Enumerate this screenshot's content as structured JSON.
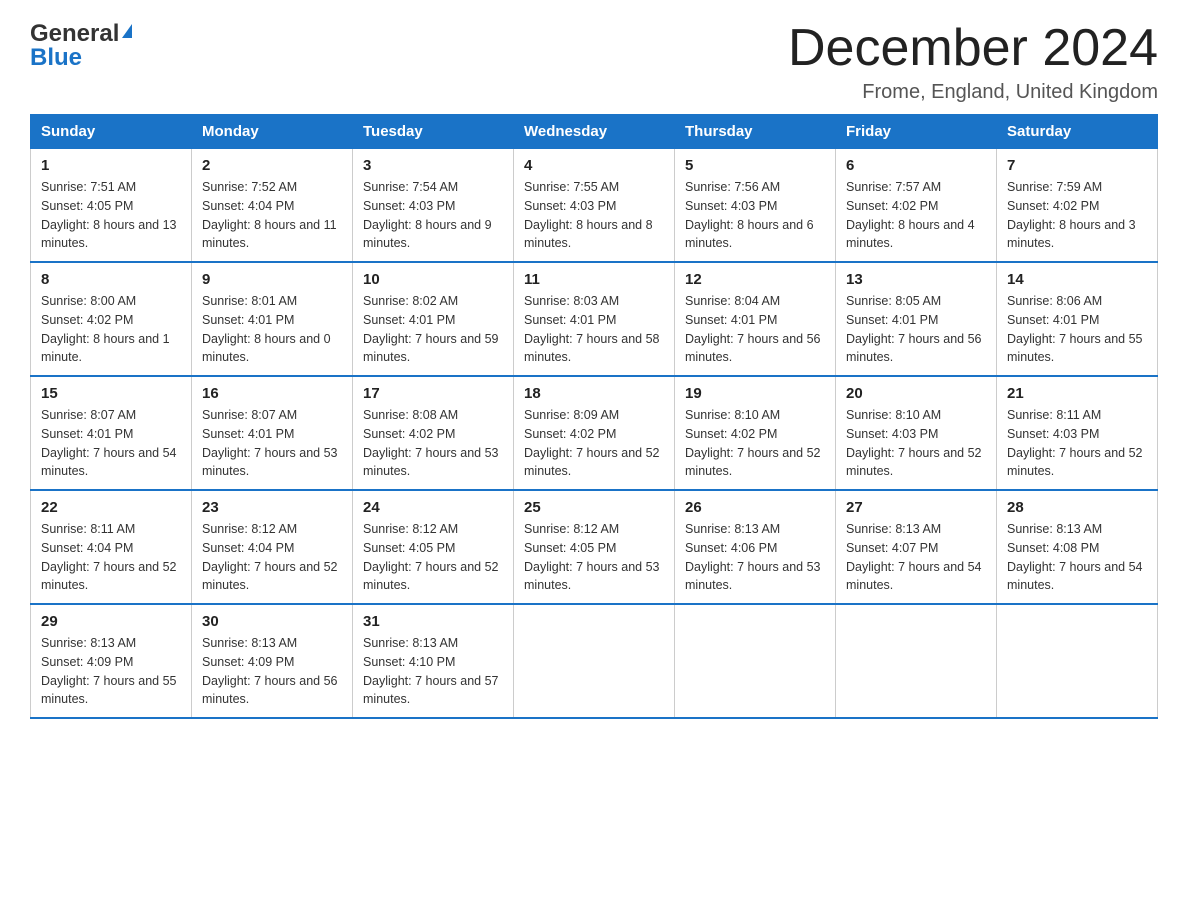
{
  "header": {
    "logo_general": "General",
    "logo_blue": "Blue",
    "title": "December 2024",
    "location": "Frome, England, United Kingdom"
  },
  "columns": [
    "Sunday",
    "Monday",
    "Tuesday",
    "Wednesday",
    "Thursday",
    "Friday",
    "Saturday"
  ],
  "weeks": [
    [
      {
        "day": "1",
        "sunrise": "7:51 AM",
        "sunset": "4:05 PM",
        "daylight": "8 hours and 13 minutes."
      },
      {
        "day": "2",
        "sunrise": "7:52 AM",
        "sunset": "4:04 PM",
        "daylight": "8 hours and 11 minutes."
      },
      {
        "day": "3",
        "sunrise": "7:54 AM",
        "sunset": "4:03 PM",
        "daylight": "8 hours and 9 minutes."
      },
      {
        "day": "4",
        "sunrise": "7:55 AM",
        "sunset": "4:03 PM",
        "daylight": "8 hours and 8 minutes."
      },
      {
        "day": "5",
        "sunrise": "7:56 AM",
        "sunset": "4:03 PM",
        "daylight": "8 hours and 6 minutes."
      },
      {
        "day": "6",
        "sunrise": "7:57 AM",
        "sunset": "4:02 PM",
        "daylight": "8 hours and 4 minutes."
      },
      {
        "day": "7",
        "sunrise": "7:59 AM",
        "sunset": "4:02 PM",
        "daylight": "8 hours and 3 minutes."
      }
    ],
    [
      {
        "day": "8",
        "sunrise": "8:00 AM",
        "sunset": "4:02 PM",
        "daylight": "8 hours and 1 minute."
      },
      {
        "day": "9",
        "sunrise": "8:01 AM",
        "sunset": "4:01 PM",
        "daylight": "8 hours and 0 minutes."
      },
      {
        "day": "10",
        "sunrise": "8:02 AM",
        "sunset": "4:01 PM",
        "daylight": "7 hours and 59 minutes."
      },
      {
        "day": "11",
        "sunrise": "8:03 AM",
        "sunset": "4:01 PM",
        "daylight": "7 hours and 58 minutes."
      },
      {
        "day": "12",
        "sunrise": "8:04 AM",
        "sunset": "4:01 PM",
        "daylight": "7 hours and 56 minutes."
      },
      {
        "day": "13",
        "sunrise": "8:05 AM",
        "sunset": "4:01 PM",
        "daylight": "7 hours and 56 minutes."
      },
      {
        "day": "14",
        "sunrise": "8:06 AM",
        "sunset": "4:01 PM",
        "daylight": "7 hours and 55 minutes."
      }
    ],
    [
      {
        "day": "15",
        "sunrise": "8:07 AM",
        "sunset": "4:01 PM",
        "daylight": "7 hours and 54 minutes."
      },
      {
        "day": "16",
        "sunrise": "8:07 AM",
        "sunset": "4:01 PM",
        "daylight": "7 hours and 53 minutes."
      },
      {
        "day": "17",
        "sunrise": "8:08 AM",
        "sunset": "4:02 PM",
        "daylight": "7 hours and 53 minutes."
      },
      {
        "day": "18",
        "sunrise": "8:09 AM",
        "sunset": "4:02 PM",
        "daylight": "7 hours and 52 minutes."
      },
      {
        "day": "19",
        "sunrise": "8:10 AM",
        "sunset": "4:02 PM",
        "daylight": "7 hours and 52 minutes."
      },
      {
        "day": "20",
        "sunrise": "8:10 AM",
        "sunset": "4:03 PM",
        "daylight": "7 hours and 52 minutes."
      },
      {
        "day": "21",
        "sunrise": "8:11 AM",
        "sunset": "4:03 PM",
        "daylight": "7 hours and 52 minutes."
      }
    ],
    [
      {
        "day": "22",
        "sunrise": "8:11 AM",
        "sunset": "4:04 PM",
        "daylight": "7 hours and 52 minutes."
      },
      {
        "day": "23",
        "sunrise": "8:12 AM",
        "sunset": "4:04 PM",
        "daylight": "7 hours and 52 minutes."
      },
      {
        "day": "24",
        "sunrise": "8:12 AM",
        "sunset": "4:05 PM",
        "daylight": "7 hours and 52 minutes."
      },
      {
        "day": "25",
        "sunrise": "8:12 AM",
        "sunset": "4:05 PM",
        "daylight": "7 hours and 53 minutes."
      },
      {
        "day": "26",
        "sunrise": "8:13 AM",
        "sunset": "4:06 PM",
        "daylight": "7 hours and 53 minutes."
      },
      {
        "day": "27",
        "sunrise": "8:13 AM",
        "sunset": "4:07 PM",
        "daylight": "7 hours and 54 minutes."
      },
      {
        "day": "28",
        "sunrise": "8:13 AM",
        "sunset": "4:08 PM",
        "daylight": "7 hours and 54 minutes."
      }
    ],
    [
      {
        "day": "29",
        "sunrise": "8:13 AM",
        "sunset": "4:09 PM",
        "daylight": "7 hours and 55 minutes."
      },
      {
        "day": "30",
        "sunrise": "8:13 AM",
        "sunset": "4:09 PM",
        "daylight": "7 hours and 56 minutes."
      },
      {
        "day": "31",
        "sunrise": "8:13 AM",
        "sunset": "4:10 PM",
        "daylight": "7 hours and 57 minutes."
      },
      null,
      null,
      null,
      null
    ]
  ]
}
